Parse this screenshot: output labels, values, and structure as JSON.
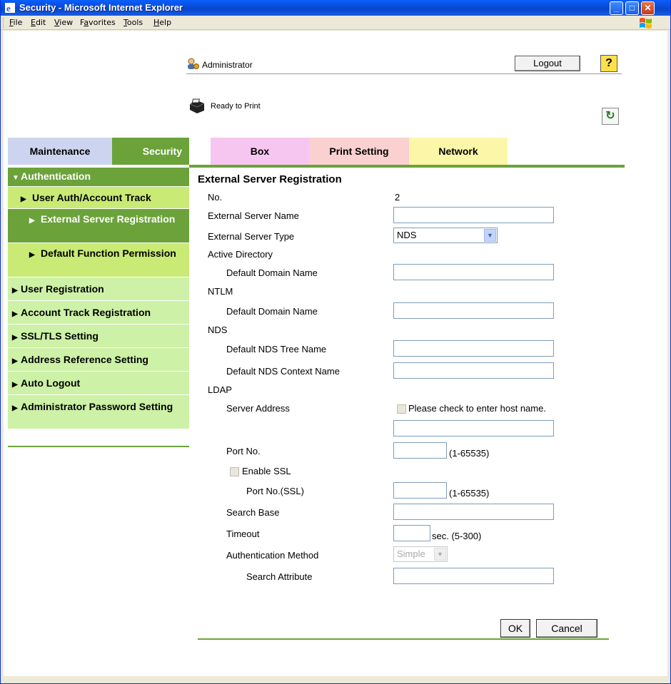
{
  "window": {
    "title": "Security - Microsoft Internet Explorer",
    "minimize": "_",
    "maximize": "□",
    "close": "✕"
  },
  "menu": [
    {
      "key": "F",
      "rest": "ile"
    },
    {
      "key": "E",
      "rest": "dit"
    },
    {
      "key": "V",
      "rest": "iew"
    },
    {
      "key": "a",
      "pre": "F",
      "rest": "vorites"
    },
    {
      "key": "T",
      "rest": "ools"
    },
    {
      "key": "H",
      "rest": "elp"
    }
  ],
  "header": {
    "user": "Administrator",
    "logout": "Logout",
    "help": "?",
    "status": "Ready to Print"
  },
  "tabs": [
    "Maintenance",
    "Security",
    "Box",
    "Print Setting",
    "Network"
  ],
  "sidebar": {
    "authentication": "Authentication",
    "sub": [
      "User Auth/Account Track",
      "External Server Registration",
      "Default Function Permission"
    ],
    "items": [
      "User Registration",
      "Account Track Registration",
      "SSL/TLS Setting",
      "Address Reference Setting",
      "Auto Logout",
      "Administrator Password Setting"
    ]
  },
  "form": {
    "title": "External Server Registration",
    "no_label": "No.",
    "no_value": "2",
    "server_name": "External Server Name",
    "server_type": "External Server Type",
    "server_type_value": "NDS",
    "active_directory": "Active Directory",
    "ad_domain": "Default Domain Name",
    "ntlm": "NTLM",
    "ntlm_domain": "Default Domain Name",
    "nds": "NDS",
    "nds_tree": "Default NDS Tree Name",
    "nds_context": "Default NDS Context Name",
    "ldap": "LDAP",
    "server_address": "Server Address",
    "host_check": "Please check to enter host name.",
    "port_no": "Port No.",
    "port_range": "(1-65535)",
    "enable_ssl": "Enable SSL",
    "port_ssl": "Port No.(SSL)",
    "port_ssl_range": "(1-65535)",
    "search_base": "Search Base",
    "timeout": "Timeout",
    "timeout_range": "sec. (5-300)",
    "auth_method": "Authentication Method",
    "auth_method_value": "Simple",
    "search_attr": "Search Attribute",
    "ok": "OK",
    "cancel": "Cancel"
  }
}
